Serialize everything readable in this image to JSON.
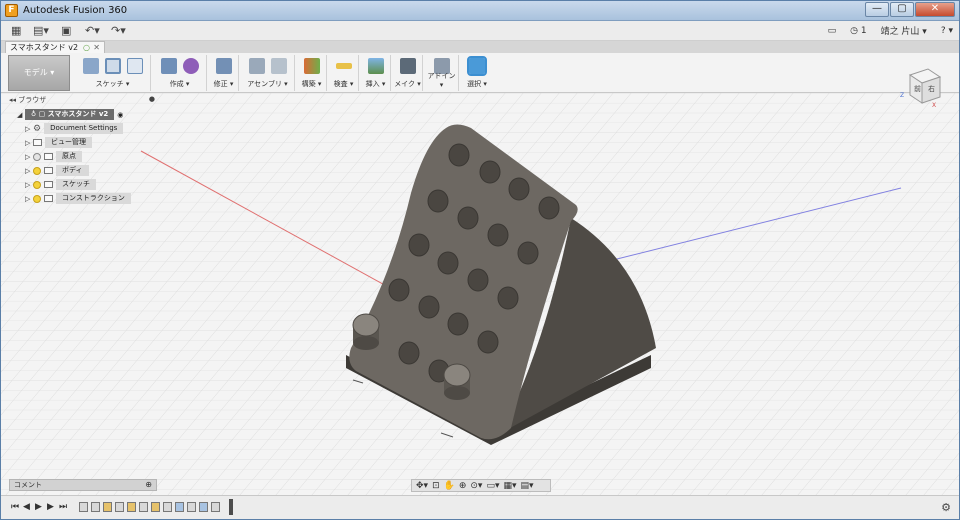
{
  "window": {
    "title": "Autodesk Fusion 360",
    "app_icon_letter": "F",
    "buttons": {
      "minimize": "—",
      "maximize": "▢",
      "close": "✕"
    }
  },
  "qat": {
    "grid_icon": "apps-grid-icon",
    "file_icon": "file-icon",
    "save_icon": "save-icon",
    "undo_icon": "undo-icon",
    "redo_icon": "redo-icon",
    "job_count": "1",
    "user_name": "靖之 片山",
    "help_label": "?"
  },
  "document_tab": {
    "label": "スマホスタンド v2"
  },
  "ribbon": {
    "workspace_label": "モデル ▾",
    "groups": [
      {
        "label": "スケッチ ▾"
      },
      {
        "label": "作成 ▾"
      },
      {
        "label": "修正 ▾"
      },
      {
        "label": "アセンブリ ▾"
      },
      {
        "label": "構築 ▾"
      },
      {
        "label": "検査 ▾"
      },
      {
        "label": "挿入 ▾"
      },
      {
        "label": "メイク ▾"
      },
      {
        "label": "アドイン ▾"
      },
      {
        "label": "選択 ▾"
      }
    ]
  },
  "browser": {
    "header_label": "ブラウザ",
    "items": [
      {
        "label": "スマホスタンド v2"
      },
      {
        "label": "Document Settings"
      },
      {
        "label": "ビュー管理"
      },
      {
        "label": "原点"
      },
      {
        "label": "ボディ"
      },
      {
        "label": "スケッチ"
      },
      {
        "label": "コンストラクション"
      }
    ]
  },
  "viewcube": {
    "front": "前",
    "right": "右",
    "axis_x": "X",
    "axis_z": "Z"
  },
  "comment_bar": {
    "label": "コメント"
  },
  "colors": {
    "model_body": "#5a5650",
    "model_face": "#6d6862",
    "grid_line": "#dedede",
    "axis_red": "#e07070",
    "axis_blue": "#8080e0",
    "selection_accent": "#3c8fd1"
  }
}
